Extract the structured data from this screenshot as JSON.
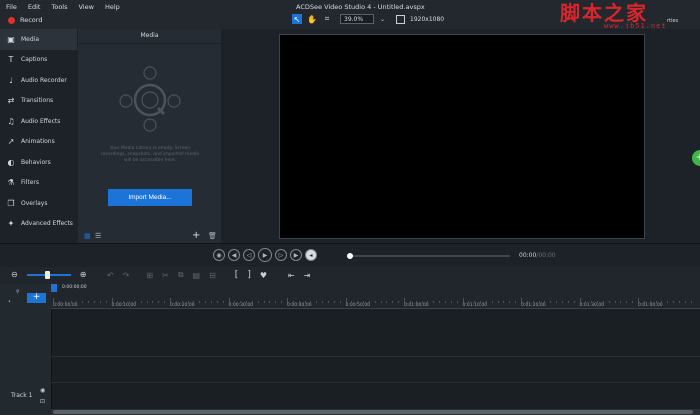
{
  "window": {
    "title": "ACDSee Video Studio 4 - Untitled.avspx"
  },
  "menu": [
    "File",
    "Edit",
    "Tools",
    "View",
    "Help"
  ],
  "record": {
    "label": "Record"
  },
  "toolbar": {
    "zoom_value": "39.0%",
    "resolution": "1920x1080",
    "peek_label": "rties"
  },
  "watermark": {
    "text": "脚本之家",
    "url": "www.jb51.net"
  },
  "sidebar": {
    "items": [
      {
        "label": "Media",
        "icon": "media-icon",
        "glyph": "▣"
      },
      {
        "label": "Captions",
        "icon": "captions-icon",
        "glyph": "T"
      },
      {
        "label": "Audio Recorder",
        "icon": "microphone-icon",
        "glyph": "♩"
      },
      {
        "label": "Transitions",
        "icon": "transitions-icon",
        "glyph": "⇄"
      },
      {
        "label": "Audio Effects",
        "icon": "audio-effects-icon",
        "glyph": "♫"
      },
      {
        "label": "Animations",
        "icon": "animations-icon",
        "glyph": "↗"
      },
      {
        "label": "Behaviors",
        "icon": "behaviors-icon",
        "glyph": "◐"
      },
      {
        "label": "Filters",
        "icon": "filters-icon",
        "glyph": "⚗"
      },
      {
        "label": "Overlays",
        "icon": "overlays-icon",
        "glyph": "❐"
      },
      {
        "label": "Advanced Effects",
        "icon": "advanced-effects-icon",
        "glyph": "✦"
      }
    ]
  },
  "media_panel": {
    "title": "Media",
    "help_text": "Your Media Library is empty. Screen recordings, snapshots, and imported media will be accessible here.",
    "import_label": "Import Media..."
  },
  "player": {
    "current_time": "00:00",
    "total_time": "00:00",
    "progress": 0
  },
  "timeline": {
    "playhead_time": "0:00:00;00",
    "ticks": [
      "0:00:00;00",
      "0:00:10;00",
      "0:00:20;00",
      "0:00:30;00",
      "0:00:40;00",
      "0:00:50;00",
      "0:01:00;00",
      "0:01:10;00",
      "0:01:20;00",
      "0:01:30;00",
      "0:01:40;00"
    ],
    "track_label": "Track 1",
    "zoom_level": 0.45
  },
  "colors": {
    "accent": "#1c74d8",
    "record": "#e0302f",
    "green": "#3fb449",
    "watermark": "#d8262c"
  }
}
